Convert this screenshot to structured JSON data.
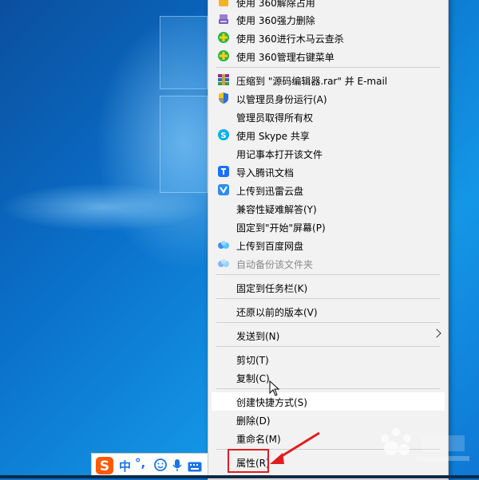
{
  "menu": {
    "items": [
      {
        "label": "使用 360解除占用",
        "icon": "360-unlock-icon"
      },
      {
        "label": "使用 360强力删除",
        "icon": "360-shred-icon"
      },
      {
        "label": "使用 360进行木马云查杀",
        "icon": "360-scan-icon"
      },
      {
        "label": "使用 360管理右键菜单",
        "icon": "360-menu-manager-icon"
      },
      {
        "label": "压缩到 \"源码编辑器.rar\" 并 E-mail",
        "icon": "winrar-icon"
      },
      {
        "label": "以管理员身份运行(A)",
        "icon": "uac-shield-icon"
      },
      {
        "label": "管理员取得所有权",
        "icon": ""
      },
      {
        "label": "使用 Skype 共享",
        "icon": "skype-icon"
      },
      {
        "label": "用记事本打开该文件",
        "icon": ""
      },
      {
        "label": "导入腾讯文档",
        "icon": "tencent-docs-icon"
      },
      {
        "label": "上传到迅雷云盘",
        "icon": "xunlei-cloud-icon"
      },
      {
        "label": "兼容性疑难解答(Y)",
        "icon": ""
      },
      {
        "label": "固定到\"开始\"屏幕(P)",
        "icon": ""
      },
      {
        "label": "上传到百度网盘",
        "icon": "baidu-netdisk-icon"
      },
      {
        "label": "自动备份该文件夹",
        "icon": "baidu-netdisk-icon",
        "disabled": true
      },
      {
        "label": "固定到任务栏(K)",
        "icon": ""
      },
      {
        "label": "还原以前的版本(V)",
        "icon": ""
      },
      {
        "label": "发送到(N)",
        "icon": "",
        "submenu": true
      },
      {
        "label": "剪切(T)",
        "icon": ""
      },
      {
        "label": "复制(C)",
        "icon": ""
      },
      {
        "label": "创建快捷方式(S)",
        "icon": "",
        "hover": true
      },
      {
        "label": "删除(D)",
        "icon": ""
      },
      {
        "label": "重命名(M)",
        "icon": ""
      },
      {
        "label": "属性(R)",
        "icon": "",
        "highlighted": true
      }
    ]
  },
  "ime": {
    "logo": "S",
    "mode": "中",
    "punct": "°,",
    "icons": [
      "emoji-icon",
      "microphone-icon",
      "keyboard-icon"
    ]
  },
  "colors": {
    "highlight": "#e11d1d",
    "menu_bg": "#f2f2f2",
    "sogou_orange": "#ff5a00",
    "ime_blue": "#1a73e8"
  }
}
